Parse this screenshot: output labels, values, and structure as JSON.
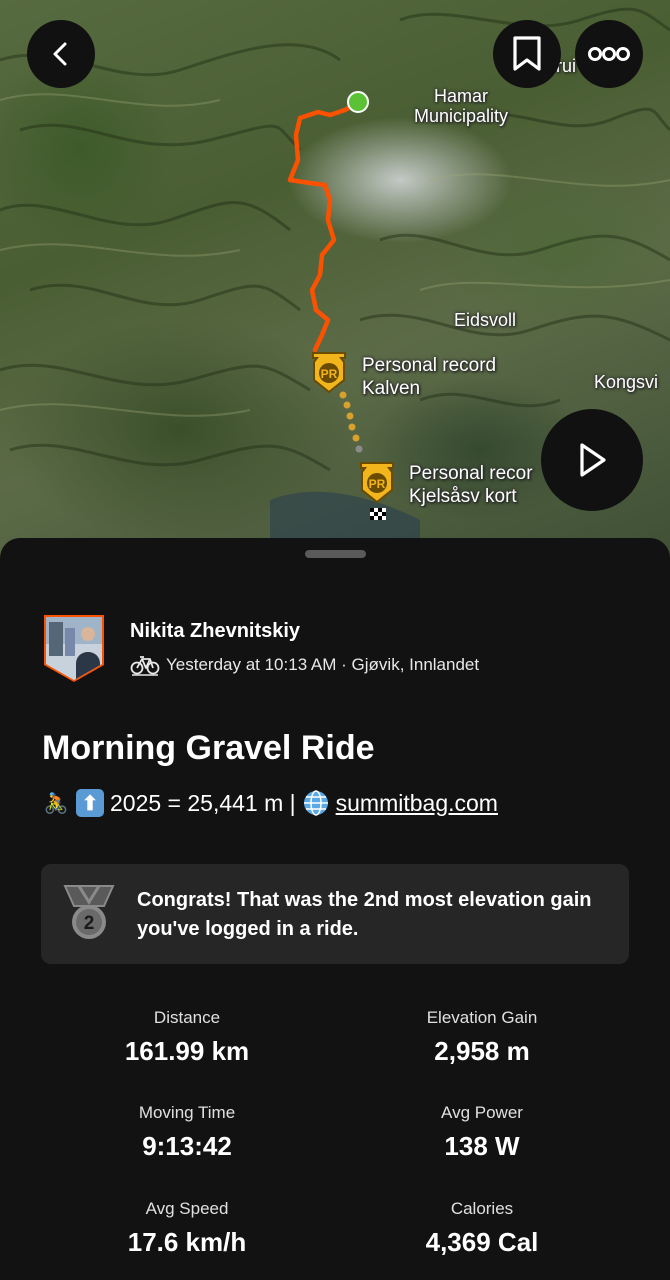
{
  "map": {
    "labels": {
      "hamar": "Hamar\nMunicipality",
      "eidsvoll": "Eidsvoll",
      "kongsvinger": "Kongsvi",
      "top_right": "rui"
    },
    "pr_markers": [
      {
        "badge": "PR",
        "line1": "Personal record",
        "line2": "Kalven"
      },
      {
        "badge": "PR",
        "line1": "Personal recor",
        "line2": "Kjelsåsv kort"
      }
    ],
    "colors": {
      "route": "#fc5200",
      "start": "#5bc236",
      "badge": "#f2b51c"
    }
  },
  "header_buttons": {
    "back_icon": "chevron-left-icon",
    "bookmark_icon": "bookmark-icon",
    "more_icon": "more-horizontal-icon",
    "play_icon": "play-icon"
  },
  "athlete": {
    "name": "Nikita Zhevnitskiy",
    "meta": "Yesterday at 10:13 AM · Gjøvik, Innlandet",
    "activity_icon": "bike-icon"
  },
  "activity": {
    "title": "Morning Gravel Ride",
    "description": {
      "emoji1": "🚴",
      "emoji2": "⬆",
      "text": "2025 = 25,441 m |",
      "emoji3": "🌐",
      "link": "summitbag.com"
    }
  },
  "achievement": {
    "rank": "2",
    "text": "Congrats! That was the 2nd most elevation gain you've logged in a ride."
  },
  "stats": [
    {
      "label": "Distance",
      "value": "161.99 km"
    },
    {
      "label": "Elevation Gain",
      "value": "2,958 m"
    },
    {
      "label": "Moving Time",
      "value": "9:13:42"
    },
    {
      "label": "Avg Power",
      "value": "138 W"
    },
    {
      "label": "Avg Speed",
      "value": "17.6 km/h"
    },
    {
      "label": "Calories",
      "value": "4,369 Cal"
    }
  ]
}
